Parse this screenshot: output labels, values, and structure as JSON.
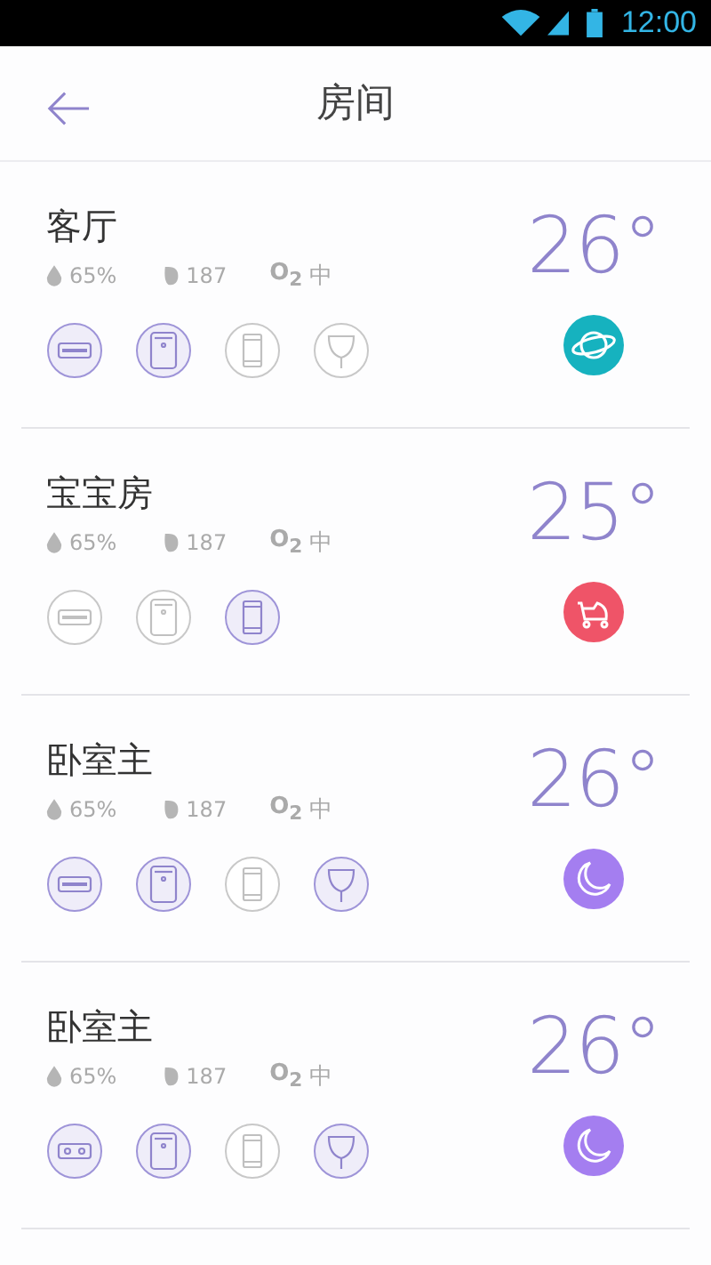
{
  "status_bar": {
    "time": "12:00"
  },
  "header": {
    "title": "房间"
  },
  "rooms": [
    {
      "name": "客厅",
      "humidity": "65%",
      "pm": "187",
      "o2_label": "O$_{2}$",
      "o2_value": "中",
      "temperature": "26°",
      "mode": {
        "kind": "planet",
        "color": "#16b2bf"
      },
      "devices": [
        {
          "kind": "aircon",
          "on": true
        },
        {
          "kind": "purifier",
          "on": true
        },
        {
          "kind": "tank",
          "on": false
        },
        {
          "kind": "lamp",
          "on": false
        }
      ]
    },
    {
      "name": "宝宝房",
      "humidity": "65%",
      "pm": "187",
      "o2_label": "O$_{2}$",
      "o2_value": "中",
      "temperature": "25°",
      "mode": {
        "kind": "stroller",
        "color": "#ef5468"
      },
      "devices": [
        {
          "kind": "aircon",
          "on": false
        },
        {
          "kind": "purifier",
          "on": false
        },
        {
          "kind": "tank",
          "on": true
        }
      ]
    },
    {
      "name": "卧室主",
      "humidity": "65%",
      "pm": "187",
      "o2_label": "O$_{2}$",
      "o2_value": "中",
      "temperature": "26°",
      "mode": {
        "kind": "moon",
        "color": "#a47ef0"
      },
      "devices": [
        {
          "kind": "aircon",
          "on": true
        },
        {
          "kind": "purifier",
          "on": true
        },
        {
          "kind": "tank",
          "on": false
        },
        {
          "kind": "lamp",
          "on": true
        }
      ]
    },
    {
      "name": "卧室主",
      "humidity": "65%",
      "pm": "187",
      "o2_label": "O$_{2}$",
      "o2_value": "中",
      "temperature": "26°",
      "mode": {
        "kind": "moon",
        "color": "#a47ef0"
      },
      "devices": [
        {
          "kind": "socket",
          "on": true
        },
        {
          "kind": "purifier",
          "on": true
        },
        {
          "kind": "tank",
          "on": false
        },
        {
          "kind": "lamp",
          "on": true
        }
      ]
    }
  ]
}
